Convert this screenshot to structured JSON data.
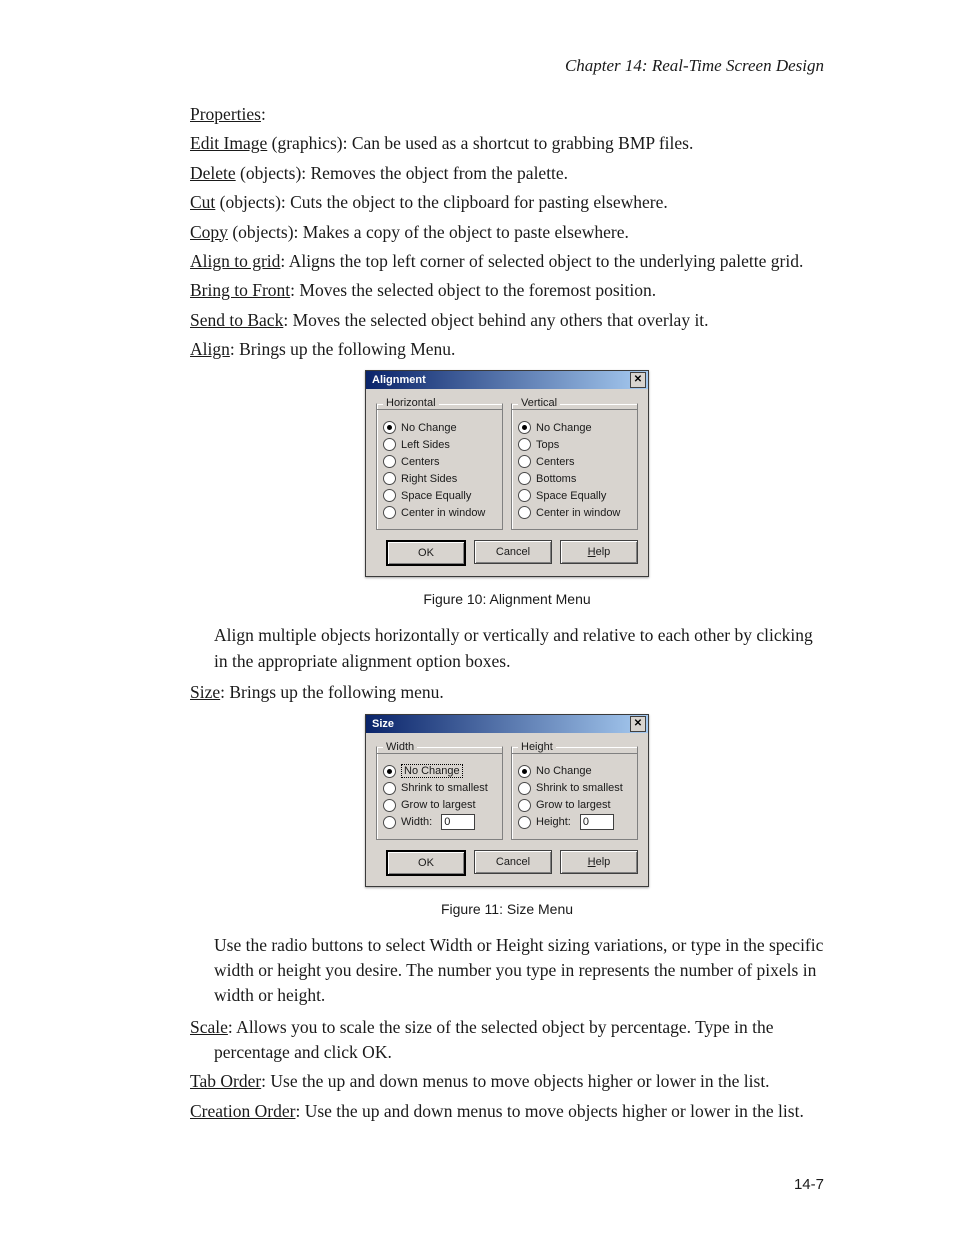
{
  "chapter_header": "Chapter 14: Real-Time Screen Design",
  "definitions": [
    {
      "term": "Properties",
      "rest": ":"
    },
    {
      "term": "Edit Image",
      "rest": " (graphics): Can be used as a shortcut to grabbing BMP files."
    },
    {
      "term": "Delete",
      "rest": " (objects): Removes the object from the palette."
    },
    {
      "term": "Cut",
      "rest": " (objects): Cuts the object to the clipboard for pasting elsewhere."
    },
    {
      "term": "Copy",
      "rest": " (objects): Makes a copy of the object to paste elsewhere."
    },
    {
      "term": "Align to grid",
      "rest": ": Aligns the top left corner of selected object to the underlying palette grid."
    },
    {
      "term": "Bring to Front",
      "rest": ": Moves the selected object to the foremost position."
    },
    {
      "term": "Send to Back",
      "rest": ": Moves the selected object behind any others that overlay it."
    },
    {
      "term": "Align",
      "rest": ": Brings up the following Menu."
    }
  ],
  "alignment_dialog": {
    "title": "Alignment",
    "close": "✕",
    "horizontal_legend": "Horizontal",
    "vertical_legend": "Vertical",
    "h_opts": [
      "No Change",
      "Left Sides",
      "Centers",
      "Right Sides",
      "Space Equally",
      "Center in window"
    ],
    "v_opts": [
      "No Change",
      "Tops",
      "Centers",
      "Bottoms",
      "Space Equally",
      "Center in window"
    ],
    "h_selected": 0,
    "v_selected": 0,
    "ok": "OK",
    "cancel": "Cancel",
    "help_prefix": "H",
    "help_rest": "elp"
  },
  "fig10_caption": "Figure 10: Alignment Menu",
  "para_after_align": "Align multiple objects horizontally or vertically and relative to each other by clicking in the appropriate alignment option boxes.",
  "size_intro": {
    "term": "Size",
    "rest": ": Brings up the following menu."
  },
  "size_dialog": {
    "title": "Size",
    "close": "✕",
    "width_legend": "Width",
    "height_legend": "Height",
    "w_opts": [
      "No Change",
      "Shrink to smallest",
      "Grow to largest"
    ],
    "h_opts": [
      "No Change",
      "Shrink to smallest",
      "Grow to largest"
    ],
    "width_label": "Width:",
    "height_label": "Height:",
    "width_value": "0",
    "height_value": "0",
    "w_selected": 0,
    "h_selected": 0,
    "ok": "OK",
    "cancel": "Cancel",
    "help_prefix": "H",
    "help_rest": "elp"
  },
  "fig11_caption": "Figure 11: Size Menu",
  "para_after_size": "Use the radio buttons to select Width or Height sizing variations, or type in the specific width or height you desire. The number you type in represents the number of pixels in width or height.",
  "trailing_defs": [
    {
      "term": "Scale",
      "rest": ": Allows you to scale the size of the selected object by percentage. Type in the percentage and click OK."
    },
    {
      "term": "Tab Order",
      "rest": ": Use the up and down menus to move objects higher or lower in the list."
    },
    {
      "term": "Creation Order",
      "rest": ": Use the up and down menus to move objects higher or lower in the list."
    }
  ],
  "page_number": "14-7"
}
